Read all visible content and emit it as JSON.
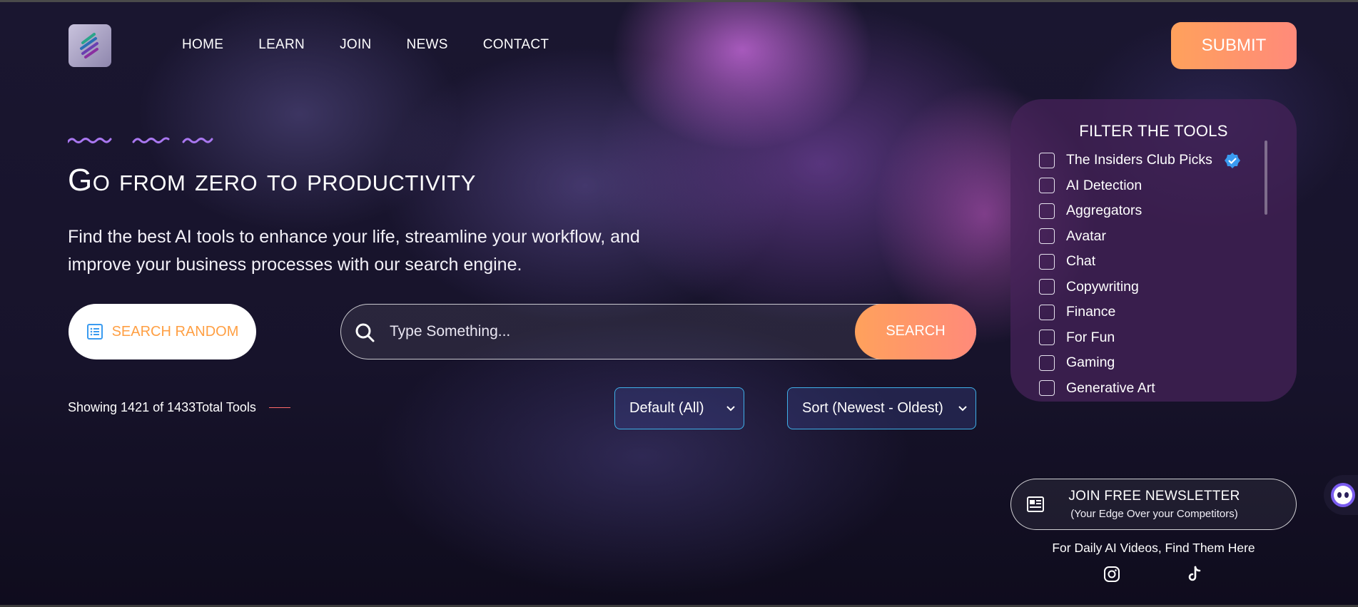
{
  "nav": {
    "items": [
      "HOME",
      "LEARN",
      "JOIN",
      "NEWS",
      "CONTACT"
    ],
    "submit_label": "SUBMIT"
  },
  "hero": {
    "title": "Go from zero to productivity",
    "subtitle_line1": "Find the best AI tools to enhance your life, streamline your workflow, and",
    "subtitle_line2": "improve your business processes with our search engine."
  },
  "search": {
    "random_label": "SEARCH RANDOM",
    "placeholder": "Type Something...",
    "button_label": "SEARCH"
  },
  "results": {
    "count_text": "Showing 1421 of 1433Total Tools",
    "category_select": "Default (All)",
    "sort_select": "Sort (Newest - Oldest)"
  },
  "filter": {
    "title": "FILTER THE TOOLS",
    "items": [
      "The Insiders Club Picks",
      "AI Detection",
      "Aggregators",
      "Avatar",
      "Chat",
      "Copywriting",
      "Finance",
      "For Fun",
      "Gaming",
      "Generative Art"
    ]
  },
  "newsletter": {
    "title": "JOIN FREE NEWSLETTER",
    "subtitle": "(Your Edge Over your Competitors)"
  },
  "social": {
    "caption": "For Daily AI Videos, Find Them Here",
    "icons": [
      "instagram-icon",
      "tiktok-icon"
    ]
  },
  "colors": {
    "accent_orange": "#ffa15c",
    "accent_pink": "#ff8a7a",
    "select_border": "#3fb0e8",
    "verified_blue": "#3a9bf0"
  }
}
